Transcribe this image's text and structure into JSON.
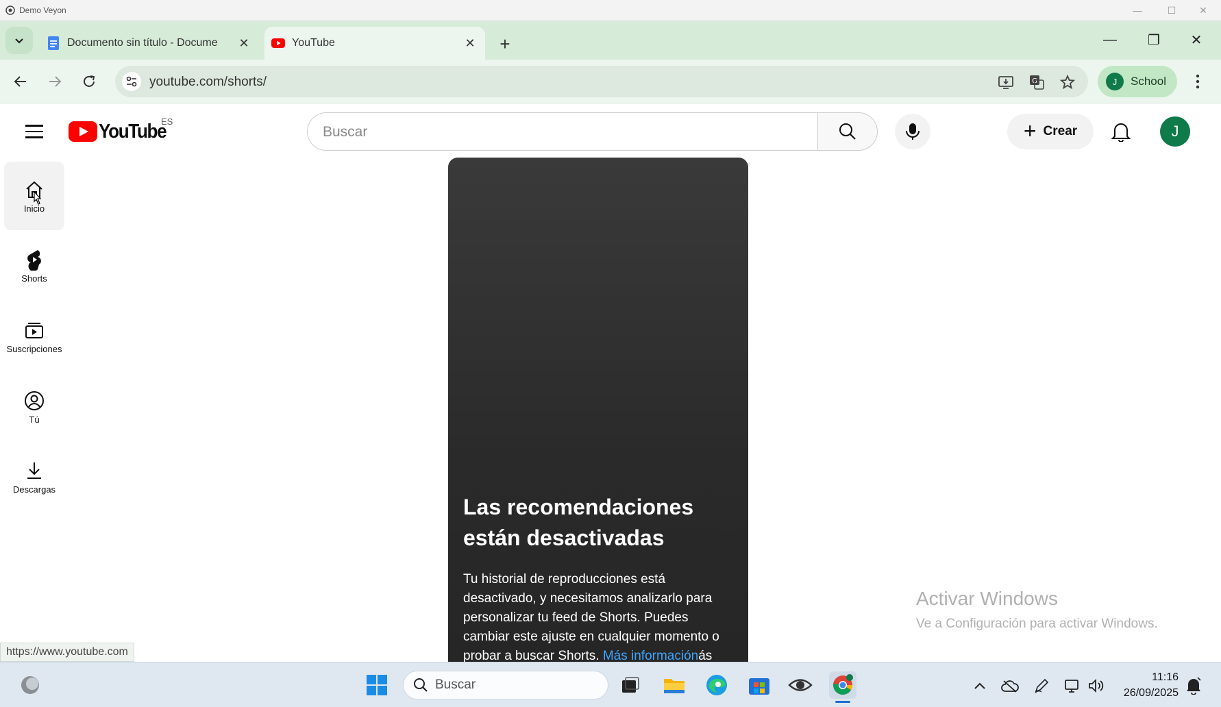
{
  "veyon": {
    "title": "Demo Veyon",
    "minimize": "—",
    "maximize": "☐",
    "close": "✕"
  },
  "browser": {
    "tabs": [
      {
        "label": "Documento sin título - Docume",
        "close": "✕"
      },
      {
        "label": "YouTube",
        "close": "✕"
      }
    ],
    "new_tab": "+",
    "window": {
      "minimize": "—",
      "restore": "❐",
      "close": "✕"
    },
    "url": "youtube.com/shorts/",
    "profile": {
      "initial": "J",
      "name": "School"
    },
    "status_url": "https://www.youtube.com"
  },
  "youtube": {
    "logo_text": "YouTube",
    "country": "ES",
    "search_placeholder": "Buscar",
    "create_label": "Crear",
    "create_plus": "+",
    "avatar_initial": "J",
    "sidebar": [
      {
        "label": "Inicio",
        "icon": "home-icon",
        "active": true
      },
      {
        "label": "Shorts",
        "icon": "shorts-icon"
      },
      {
        "label": "Suscripciones",
        "icon": "subscriptions-icon"
      },
      {
        "label": "Tú",
        "icon": "you-icon"
      },
      {
        "label": "Descargas",
        "icon": "downloads-icon"
      }
    ],
    "shorts_message": {
      "heading": "Las recomendaciones están desactivadas",
      "body": "Tu historial de reproducciones está desactivado, y necesitamos analizarlo para personalizar tu feed de Shorts. Puedes cambiar este ajuste en cualquier momento o probar a buscar Shorts.",
      "link": "Más información",
      "trailing": "ás"
    }
  },
  "activate_windows": {
    "title": "Activar Windows",
    "subtitle": "Ve a Configuración para activar Windows."
  },
  "taskbar": {
    "search_label": "Buscar",
    "time": "11:16",
    "date": "26/09/2025"
  },
  "colors": {
    "tab_strip": "#d6ebd8",
    "toolbar": "#edf6ee",
    "yt_red": "#ff0000",
    "link_blue": "#3ea6ff",
    "avatar_green": "#0f7a4a"
  }
}
